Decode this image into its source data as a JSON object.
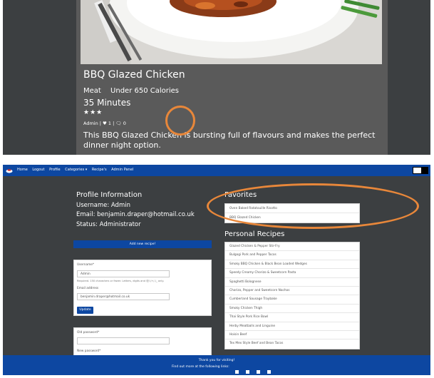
{
  "recipe_card": {
    "title": "BBQ Glazed Chicken",
    "category": "Meat",
    "calories": "Under 650 Calories",
    "time": "35 Minutes",
    "rating_stars": "★★★",
    "meta": "Admin | ♥ 1 | 🗨 0",
    "description": "This BBQ Glazed Chicken is bursting full of flavours and makes the perfect dinner night option."
  },
  "navbar": {
    "items": [
      "Home",
      "Logout",
      "Profile",
      "Categories ▾",
      "Recipe's",
      "Admin Panel"
    ]
  },
  "profile": {
    "heading": "Profile Information",
    "username_line": "Username: Admin",
    "email_line": "Email: benjamin.draper@hotmail.co.uk",
    "status_line": "Status: Administrator"
  },
  "add_recipe_label": "Add new recipe!",
  "user_form": {
    "username_label": "Username*",
    "username_value": "Admin",
    "username_help": "Required. 150 characters or fewer. Letters, digits and @/./+/-/_ only.",
    "email_label": "Email address",
    "email_value": "benjamin.draper@hotmail.co.uk",
    "update_label": "Update"
  },
  "password_form": {
    "old_label": "Old password*",
    "new_label": "New password*"
  },
  "favorites": {
    "heading": "Favorites",
    "items": [
      "Oven Baked Ratatouille Risotto",
      "BBQ Glazed Chicken"
    ]
  },
  "personal_recipes": {
    "heading": "Personal Recipes",
    "items": [
      "Glazed Chicken & Pepper Stir-Fry",
      "Bulgogi Pork and Pepper Tacos",
      "Smoky BBQ Chicken & Black Bean Loaded Wedges",
      "Speedy Creamy Chorizo & Sweetcorn Pasta",
      "Spaghetti Bolognese",
      "Chorizo, Pepper and Sweetcorn Nachos",
      "Cumberland Sausage Traybake",
      "Smoky Chicken Thigh",
      "Thai Style Pork Rice Bowl",
      "Herby Meatballs and Linguine",
      "Hoisin Beef",
      "Tex Mex Style Beef and Bean Tacos"
    ]
  },
  "footer": {
    "line1": "Thank you for visiting!",
    "line2": "Find out more at the following links:"
  },
  "colors": {
    "navbar": "#0d47a1",
    "page_background": "#3c3f41",
    "card_background": "#5a5a5a",
    "annotation_circle": "#e8873a"
  }
}
